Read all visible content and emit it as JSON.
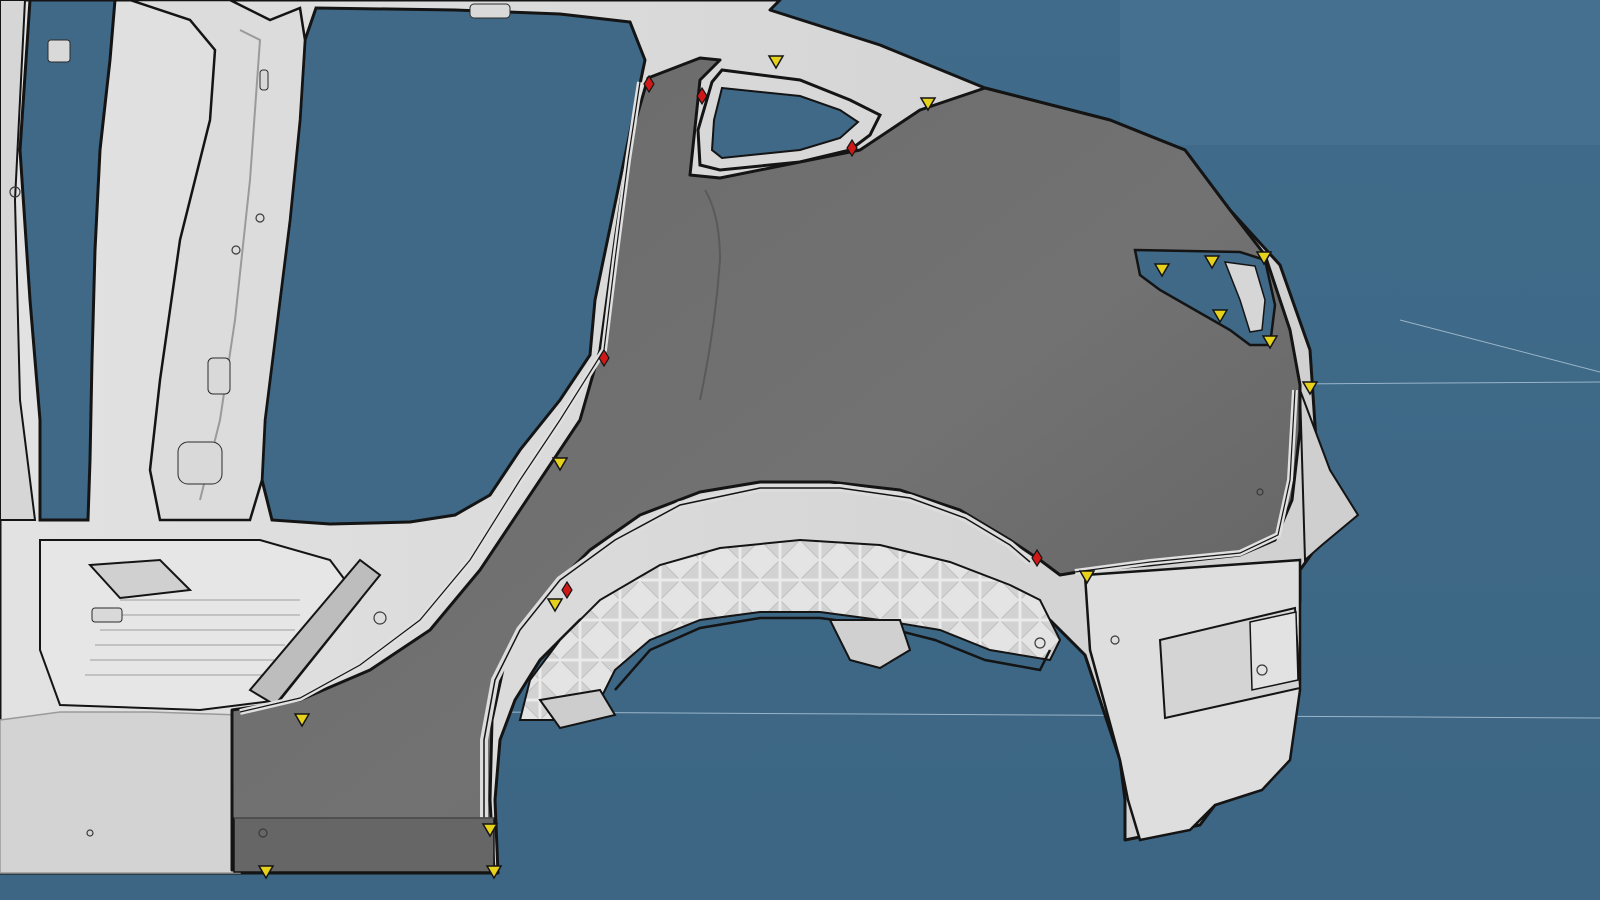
{
  "viewport": {
    "background_color": "#3f6987",
    "body_color": "#dcdcdc",
    "panel_color": "#707070",
    "outline_color": "#141414"
  },
  "markers": {
    "clip_marker": {
      "icon": "yellow-triangle-icon",
      "color": "#e6d21c"
    },
    "weld_marker": {
      "icon": "red-diamond-icon",
      "color": "#d01818"
    }
  }
}
